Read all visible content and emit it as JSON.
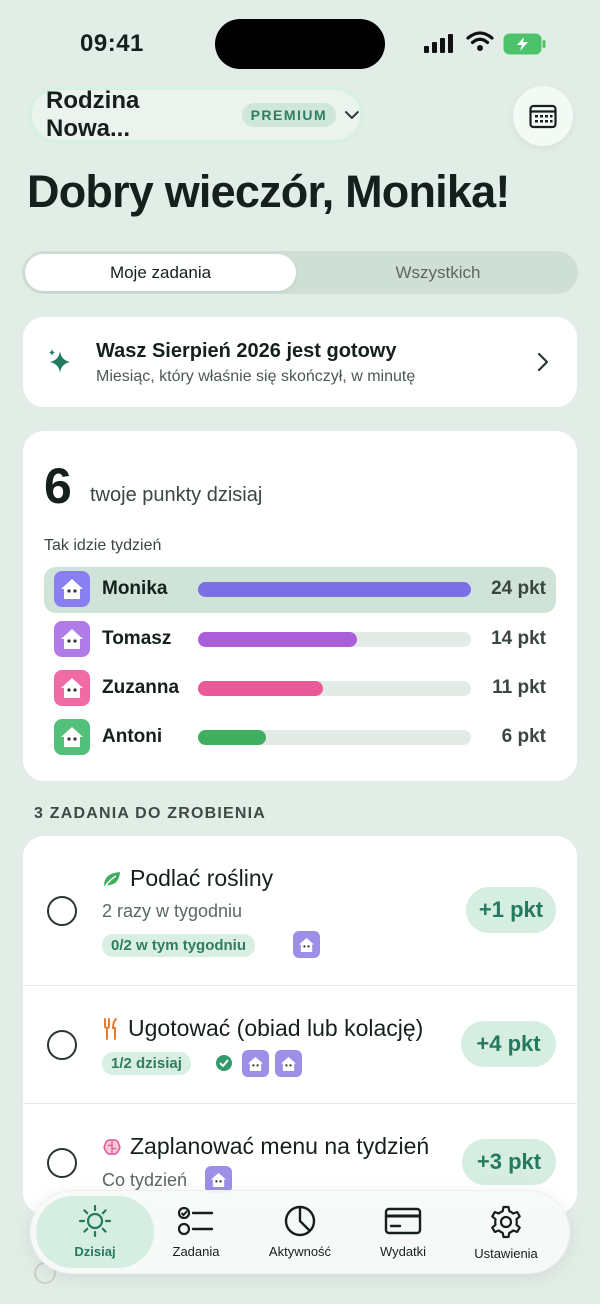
{
  "status_bar": {
    "time": "09:41"
  },
  "header": {
    "family_name": "Rodzina Nowa...",
    "plan_badge": "PREMIUM",
    "greeting": "Dobry wieczór, Monika!"
  },
  "segmented": {
    "active": "Moje zadania",
    "other": "Wszystkich"
  },
  "summary": {
    "title": "Wasz Sierpień 2026 jest gotowy",
    "subtitle": "Miesiąc, który właśnie się skończył, w minutę"
  },
  "points": {
    "value": "6",
    "label": "twoje punkty dzisiaj",
    "week_label": "Tak idzie tydzień",
    "members": [
      {
        "name": "Monika",
        "points_text": "24 pkt",
        "points": 24,
        "color": "#7b6fe6",
        "avatar": "#8a7ff0"
      },
      {
        "name": "Tomasz",
        "points_text": "14 pkt",
        "points": 14,
        "color": "#a95fd9",
        "avatar": "#b07be6"
      },
      {
        "name": "Zuzanna",
        "points_text": "11 pkt",
        "points": 11,
        "color": "#ea5a99",
        "avatar": "#f06aa4"
      },
      {
        "name": "Antoni",
        "points_text": "6 pkt",
        "points": 6,
        "color": "#3fae5e",
        "avatar": "#52c07a"
      }
    ]
  },
  "tasks_section": {
    "title": "3 ZADANIA DO ZROBIENIA"
  },
  "tasks": [
    {
      "title": "Podlać rośliny",
      "icon": "leaf-icon",
      "subtitle": "2 razy w tygodniu",
      "tag": "0/2 w tym tygodniu",
      "points": "+1 pkt"
    },
    {
      "title": "Ugotować (obiad lub kolację)",
      "icon": "fork-knife-icon",
      "tag": "1/2 dzisiaj",
      "points": "+4 pkt"
    },
    {
      "title": "Zaplanować menu na tydzień",
      "icon": "brain-icon",
      "subtitle": "Co tydzień",
      "points": "+3 pkt"
    }
  ],
  "tabbar": [
    {
      "label": "Dzisiaj",
      "icon": "sun-icon",
      "active": true
    },
    {
      "label": "Zadania",
      "icon": "checklist-icon",
      "active": false
    },
    {
      "label": "Aktywność",
      "icon": "pie-chart-icon",
      "active": false
    },
    {
      "label": "Wydatki",
      "icon": "wallet-icon",
      "active": false
    },
    {
      "label": "Ustawienia",
      "icon": "gear-icon",
      "active": false
    }
  ]
}
